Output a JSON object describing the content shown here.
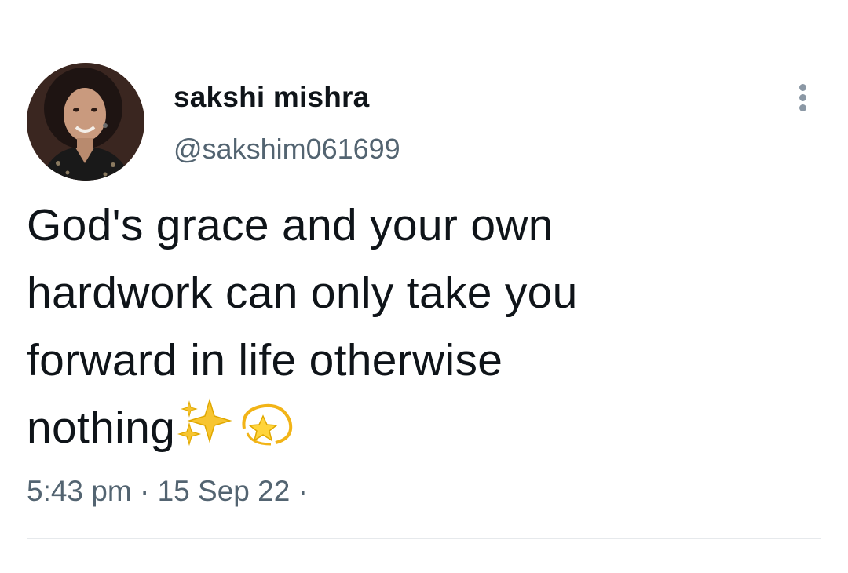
{
  "tweet": {
    "author": {
      "display_name": "sakshi mishra",
      "handle": "@sakshim061699"
    },
    "text_lines": [
      "God's grace and your own",
      "hardwork can only take you",
      "forward in life otherwise",
      "nothing"
    ],
    "emojis": [
      "sparkles-icon",
      "dizzy-star-icon"
    ],
    "time": "5:43 pm",
    "separator": "·",
    "date": "15 Sep 22"
  },
  "icons": {
    "more": "vertical-ellipsis-icon"
  },
  "colors": {
    "text": "#0f1419",
    "secondary": "#536471",
    "divider": "#e6e9ec",
    "more_dots": "#8b98a5"
  }
}
